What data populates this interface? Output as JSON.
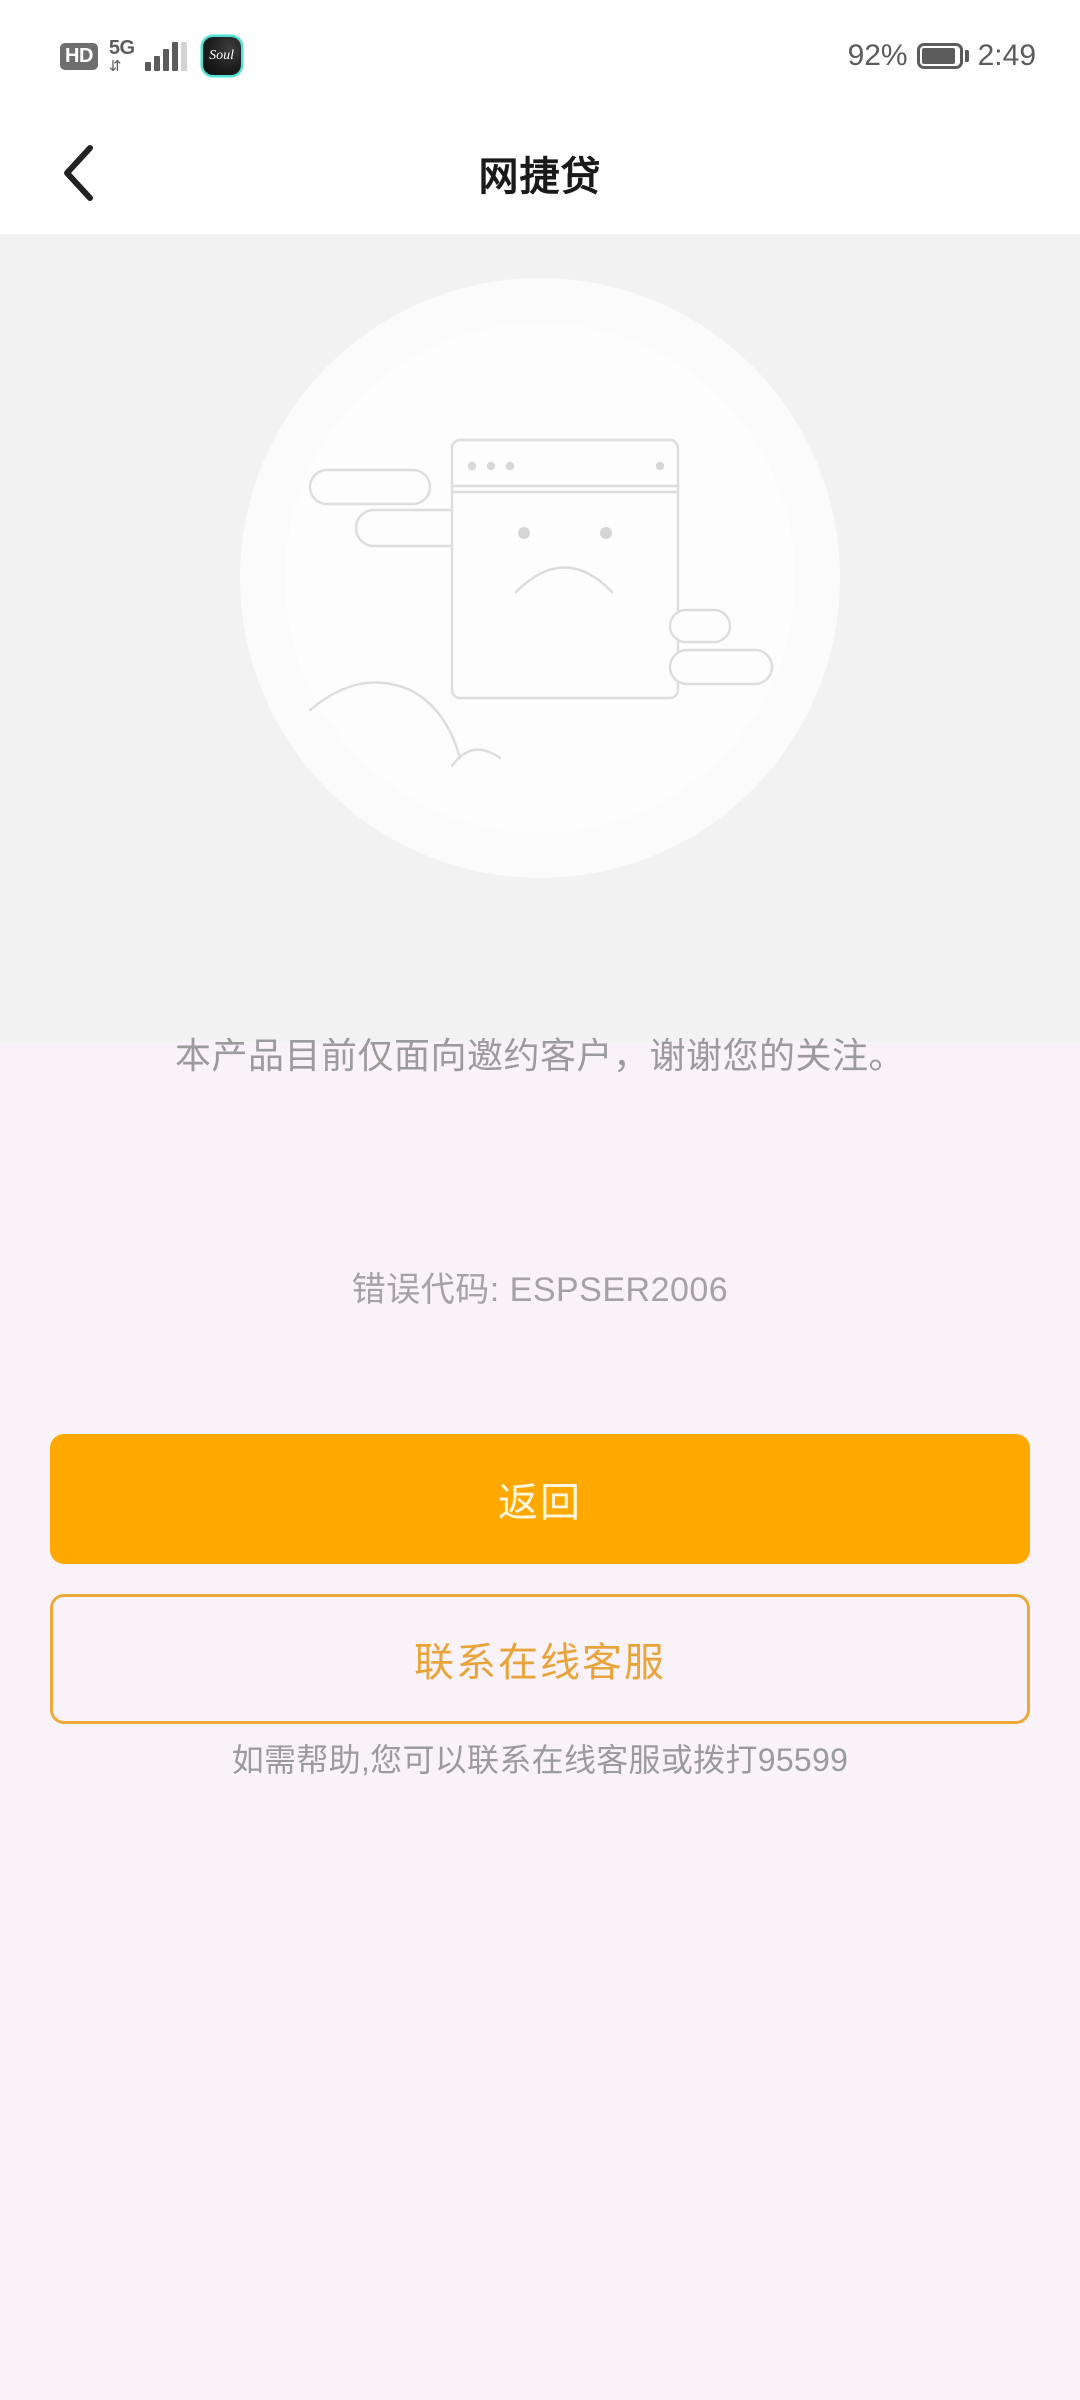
{
  "status_bar": {
    "hd_label": "HD",
    "network_label": "5G",
    "data_arrows": "⇵",
    "app_badge_label": "Soul",
    "battery_percent": "92%",
    "battery_level": 92,
    "clock": "2:49",
    "icons": {
      "hd": "hd-badge-icon",
      "signal": "signal-bars-icon",
      "battery": "battery-icon",
      "app_badge": "soul-app-icon"
    }
  },
  "nav_bar": {
    "title": "网捷贷",
    "back_icon": "chevron-left-icon"
  },
  "content": {
    "illustration_name": "sad-face-browser-empty-state-illustration",
    "message": "本产品目前仅面向邀约客户，谢谢您的关注。",
    "error_code": "错误代码: ESPSER2006"
  },
  "actions": {
    "primary_label": "返回",
    "secondary_label": "联系在线客服"
  },
  "footer": {
    "help_text": "如需帮助,您可以联系在线客服或拨打95599"
  },
  "colors": {
    "accent_orange": "#ffa800",
    "accent_orange_outline": "#eda93a",
    "page_background": "#f9f2f9",
    "panel_background": "#f2f2f2",
    "nav_background": "#ffffff",
    "muted_text": "#9b9b9b"
  }
}
